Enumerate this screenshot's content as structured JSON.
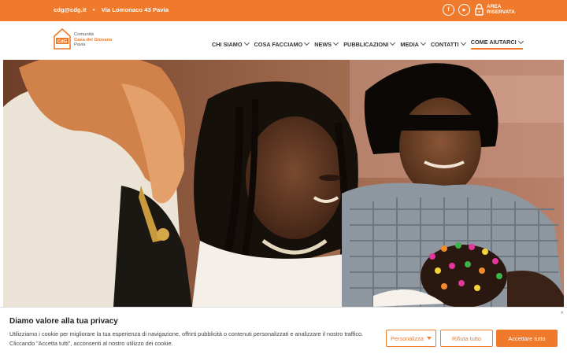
{
  "topbar": {
    "email": "cdg@cdg.it",
    "separator": "•",
    "address": "Via Lomonaco 43 Pavia",
    "social": [
      {
        "icon": "facebook-icon",
        "glyph": "f"
      },
      {
        "icon": "youtube-icon",
        "glyph": "▶"
      }
    ],
    "area_riservata": [
      "AREA",
      "RISERVATA"
    ]
  },
  "logo": {
    "mark": "CdG",
    "line1": "Comunità",
    "line2": "Casa del Giovane",
    "line3": "Pavia"
  },
  "nav": {
    "items": [
      {
        "label": "CHI SIAMO"
      },
      {
        "label": "COSA FACCIAMO"
      },
      {
        "label": "NEWS"
      },
      {
        "label": "PUBBLICAZIONI"
      },
      {
        "label": "MEDIA"
      },
      {
        "label": "CONTATTI"
      },
      {
        "label": "COME AIUTARCI",
        "active": true
      }
    ]
  },
  "cookie": {
    "close": "×",
    "title": "Diamo valore alla tua privacy",
    "text": "Utilizziamo i cookie per migliorare la tua esperienza di navigazione, offrirti pubblicità o contenuti personalizzati e analizzare il nostro traffico. Cliccando \"Accetta tutti\", acconsenti al nostro utilizzo dei cookie.",
    "personalizza": "Personalizza",
    "rifiuta": "Rifiuta tutto",
    "accetta": "Accettare tutto"
  },
  "colors": {
    "accent": "#f07a2b"
  }
}
